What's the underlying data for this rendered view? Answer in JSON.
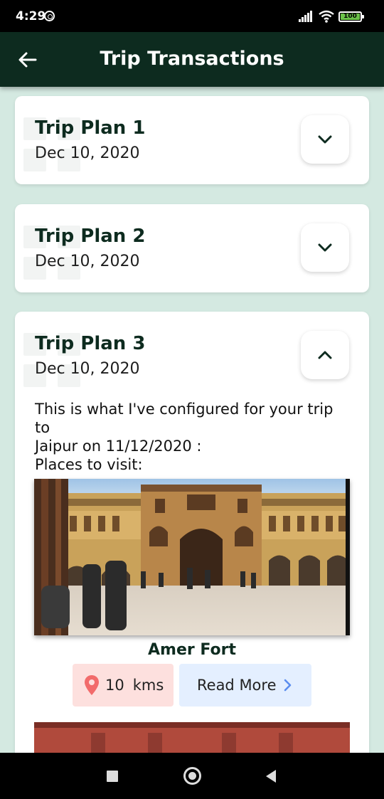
{
  "status_bar": {
    "time": "4:29",
    "battery": "100"
  },
  "app_bar": {
    "title": "Trip Transactions",
    "back_icon": "arrow-left-icon"
  },
  "trips": [
    {
      "title": "Trip Plan 1",
      "date": "Dec 10, 2020",
      "expanded": false,
      "toggle_icon": "chevron-down-icon"
    },
    {
      "title": "Trip Plan 2",
      "date": "Dec 10, 2020",
      "expanded": false,
      "toggle_icon": "chevron-down-icon"
    },
    {
      "title": "Trip Plan 3",
      "date": "Dec 10, 2020",
      "expanded": true,
      "toggle_icon": "chevron-up-icon",
      "description": "This is what I've configured for your trip to\nJaipur on 11/12/2020 :\nPlaces to visit:",
      "places": [
        {
          "name": "Amer Fort",
          "distance_value": "10",
          "distance_unit": "kms",
          "read_more_label": "Read More"
        }
      ]
    }
  ],
  "colors": {
    "app_bar": "#0d2b1f",
    "background": "#d4e9e1",
    "distance_chip": "#fde0de",
    "read_more": "#e4efff",
    "pin": "#f26b6b",
    "chevron_blue": "#5b8def"
  }
}
